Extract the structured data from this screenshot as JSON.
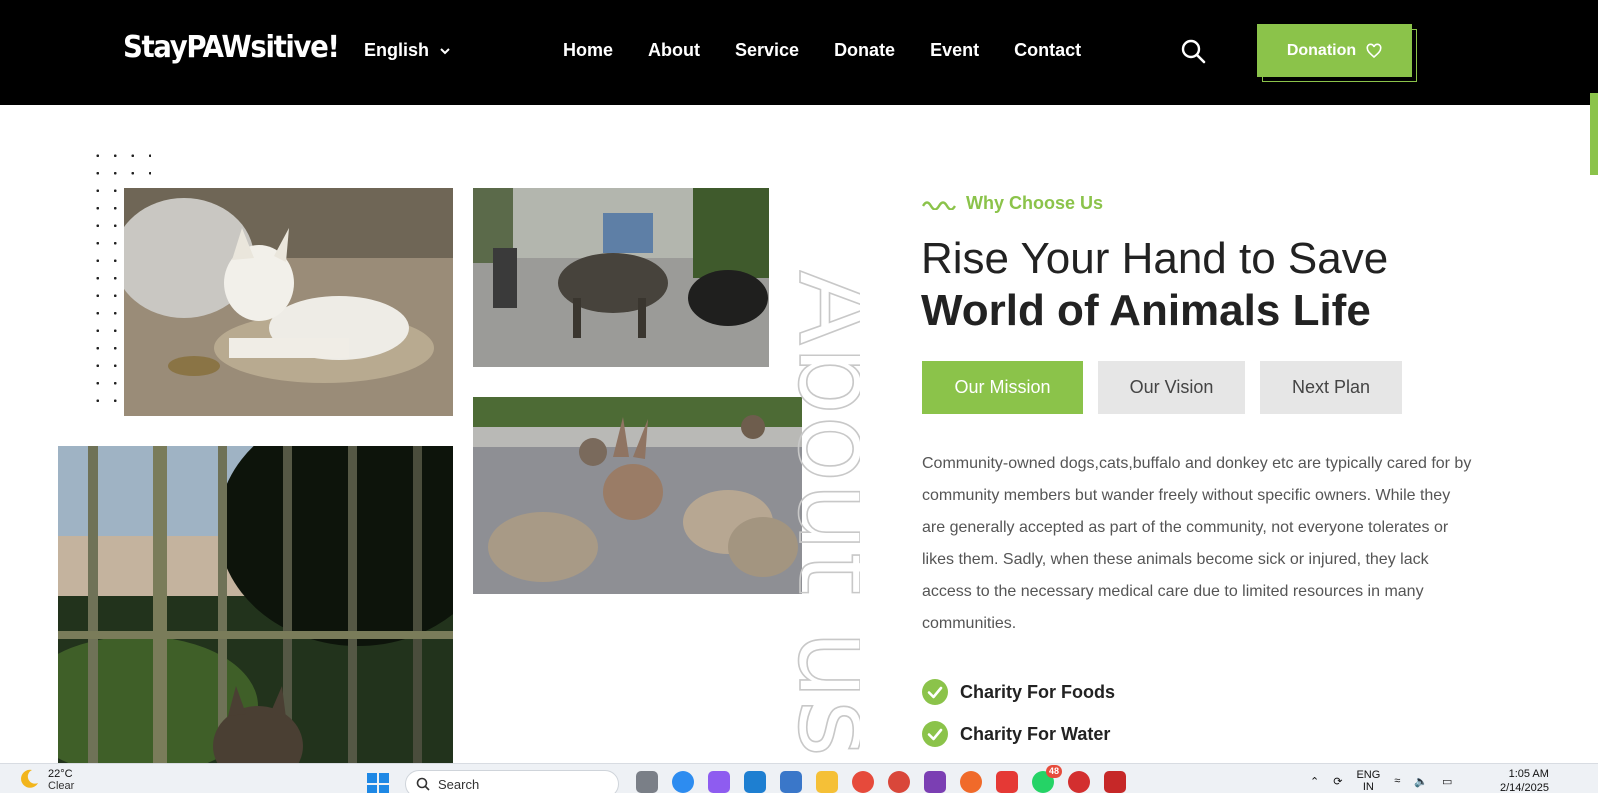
{
  "header": {
    "logo": "StayPAWsitive!",
    "language": "English",
    "nav": [
      "Home",
      "About",
      "Service",
      "Donate",
      "Event",
      "Contact"
    ],
    "donation_label": "Donation",
    "icons": {
      "search": "search-icon",
      "heart": "heart-icon",
      "chevron": "chevron-down-icon"
    }
  },
  "colors": {
    "accent": "#8bc34a",
    "header_bg": "#000000",
    "tab_inactive": "#e6e6e6",
    "heading": "#222222"
  },
  "section": {
    "kicker": "Why Choose Us",
    "heading_line1": "Rise Your Hand to Save",
    "heading_line2": "World of Animals Life",
    "tabs": [
      {
        "label": "Our Mission",
        "active": true
      },
      {
        "label": "Our Vision",
        "active": false
      },
      {
        "label": "Next Plan",
        "active": false
      }
    ],
    "paragraph": "Community-owned dogs,cats,buffalo and donkey etc are typically cared for by community members but wander freely without specific owners. While they are generally accepted as part of the community, not everyone tolerates or likes them. Sadly, when these animals become sick or injured, they lack access to the necessary medical care due to limited resources in many communities.",
    "checklist": [
      "Charity For Foods",
      "Charity For Water"
    ],
    "vertical_watermark": "About us"
  },
  "taskbar": {
    "temperature": "22°C",
    "condition": "Clear",
    "search_placeholder": "Search",
    "whatsapp_badge": "48",
    "tray_lang_line1": "ENG",
    "tray_lang_line2": "IN",
    "time": "1:05 AM",
    "date": "2/14/2025"
  }
}
